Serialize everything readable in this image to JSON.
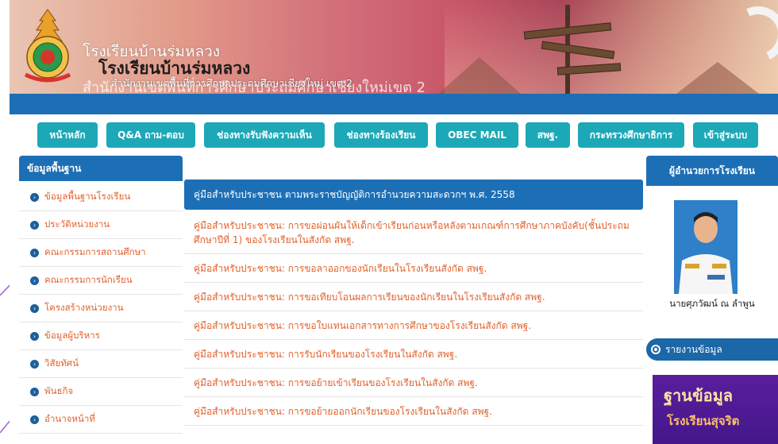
{
  "header": {
    "school_name_small": "โรงเรียนบ้านร่มหลวง",
    "school_name_bold": "โรงเรียนบ้านร่มหลวง",
    "office_ghost": "สำนักงานเขตพื้นที่การศึกษาประถมศึกษาเชียงใหม่เขต 2",
    "office_line": "สำนักงานเขตพื้นที่การศึกษาประถมศึกษาเชียงใหม่ เขต 2"
  },
  "nav": {
    "items": [
      {
        "label": "หน้าหลัก"
      },
      {
        "label": "Q&A ถาม-ตอบ"
      },
      {
        "label": "ช่องทางรับฟังความเห็น"
      },
      {
        "label": "ช่องทางร้องเรียน"
      },
      {
        "label": "OBEC MAIL"
      },
      {
        "label": "สพฐ."
      },
      {
        "label": "กระทรวงศึกษาธิการ"
      },
      {
        "label": "เข้าสู่ระบบ"
      }
    ]
  },
  "sidebar": {
    "heading": "ข้อมูลพื้นฐาน",
    "items": [
      {
        "label": "ข้อมูลพื้นฐานโรงเรียน"
      },
      {
        "label": "ประวัติหน่วยงาน"
      },
      {
        "label": "คณะกรรมการสถานศึกษา"
      },
      {
        "label": "คณะกรรมการนักเรียน"
      },
      {
        "label": "โครงสร้างหน่วยงาน"
      },
      {
        "label": "ข้อมูลผู้บริหาร"
      },
      {
        "label": "วิสัยทัศน์"
      },
      {
        "label": "พันธกิจ"
      },
      {
        "label": "อำนาจหน้าที่"
      }
    ]
  },
  "main": {
    "featured": "คู่มือสำหรับประชาชน ตามพระราชบัญญัติการอำนวยความสะดวกฯ พ.ศ. 2558",
    "links": [
      {
        "label": "คู่มือสำหรับประชาชน: การขอผ่อนผันให้เด็กเข้าเรียนก่อนหรือหลังตามเกณฑ์การศึกษาภาคบังคับ(ชั้นประถมศึกษาปีที่ 1) ของโรงเรียนในสังกัด สพฐ."
      },
      {
        "label": "คู่มือสำหรับประชาชน: การขอลาออกของนักเรียนในโรงเรียนสังกัด สพฐ."
      },
      {
        "label": "คู่มือสำหรับประชาชน: การขอเทียบโอนผลการเรียนของนักเรียนในโรงเรียนสังกัด สพฐ."
      },
      {
        "label": "คู่มือสำหรับประชาชน: การขอใบแทนเอกสารทางการศึกษาของโรงเรียนสังกัด สพฐ."
      },
      {
        "label": "คู่มือสำหรับประชาชน: การรับนักเรียนของโรงเรียนในสังกัด สพฐ."
      },
      {
        "label": "คู่มือสำหรับประชาชน: การขอย้ายเข้าเรียนของโรงเรียนในสังกัด สพฐ."
      },
      {
        "label": "คู่มือสำหรับประชาชน: การขอย้ายออกนักเรียนของโรงเรียนในสังกัด สพฐ."
      }
    ]
  },
  "right": {
    "director_heading": "ผู้อำนวยการโรงเรียน",
    "director_name": "นายศุภวัฒน์ ณ ลำพูน",
    "report_heading": "รายงานข้อมูล",
    "banner_line1": "ฐานข้อมูล",
    "banner_line2": "โรงเรียนสุจริต"
  },
  "colors": {
    "primary_blue": "#1d6fb5",
    "nav_teal": "#1ca8b7",
    "link_orange": "#e2622d"
  }
}
